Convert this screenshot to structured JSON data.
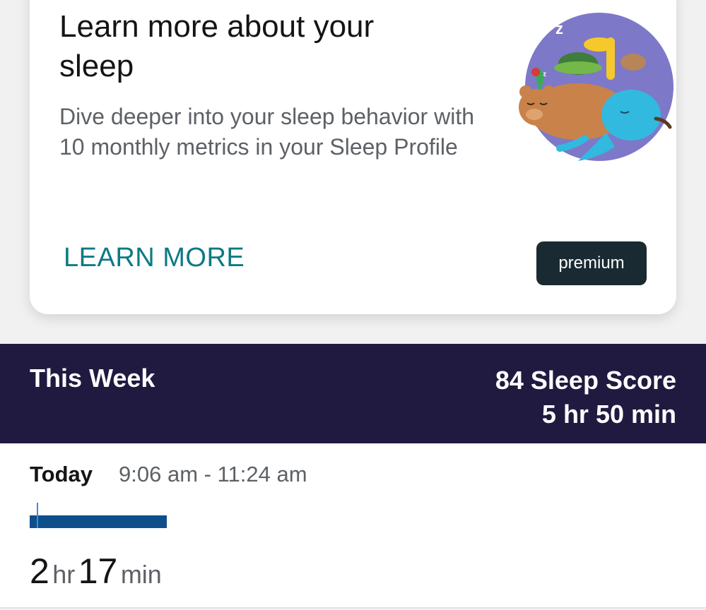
{
  "card": {
    "title": "Learn more about your sleep",
    "body": "Dive deeper into your sleep behavior with 10 monthly metrics in your Sleep Profile",
    "learn_more_label": "LEARN MORE",
    "premium_label": "premium"
  },
  "week": {
    "label": "This Week",
    "score": "84 Sleep Score",
    "duration": "5 hr 50 min"
  },
  "entry": {
    "day": "Today",
    "time_range": "9:06 am - 11:24 am",
    "hours": "2",
    "hours_unit": "hr",
    "minutes": "17",
    "minutes_unit": "min"
  },
  "colors": {
    "accent": "#0c7a84",
    "header_bg": "#201a40",
    "sleep_bar": "#0e4f8b",
    "premium_bg": "#1a2a33"
  }
}
